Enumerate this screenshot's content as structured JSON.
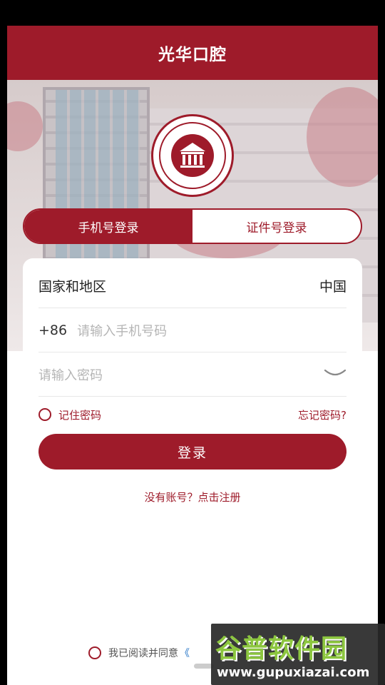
{
  "app": {
    "title": "光华口腔"
  },
  "tabs": [
    {
      "label": "手机号登录",
      "active": true
    },
    {
      "label": "证件号登录",
      "active": false
    }
  ],
  "form": {
    "region_label": "国家和地区",
    "region_value": "中国",
    "phone_prefix": "+86",
    "phone_placeholder": "请输入手机号码",
    "password_placeholder": "请输入密码",
    "remember_label": "记住密码",
    "forgot_label": "忘记密码?",
    "login_label": "登录",
    "register_label": "没有账号？点击注册"
  },
  "agreement": {
    "text": "我已阅读并同意",
    "link": "《"
  },
  "watermark": {
    "name": "谷普软件园",
    "url": "www.gupuxiazai.com"
  },
  "colors": {
    "brand": "#9e1b2a",
    "link": "#1d6fc4"
  }
}
